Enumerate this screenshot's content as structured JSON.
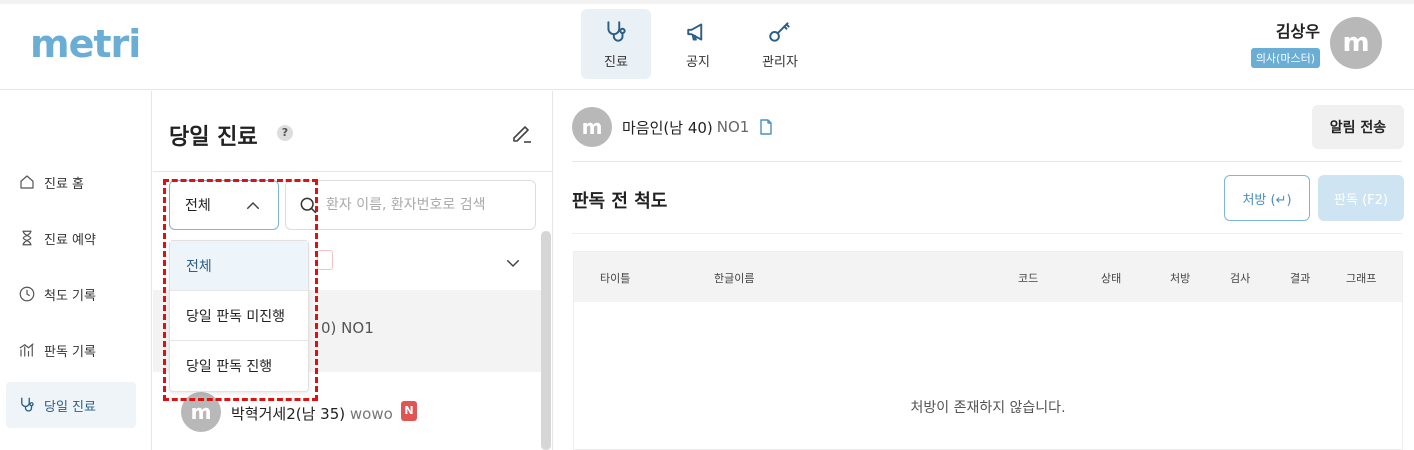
{
  "header": {
    "logo": "metri",
    "nav": [
      {
        "label": "진료",
        "icon": "stethoscope-icon",
        "active": true
      },
      {
        "label": "공지",
        "icon": "megaphone-icon",
        "active": false
      },
      {
        "label": "관리자",
        "icon": "key-icon",
        "active": false
      }
    ],
    "user": {
      "name": "김상우",
      "role": "의사(마스터)",
      "avatar_letter": "m"
    }
  },
  "sidebar": {
    "items": [
      {
        "label": "진료 홈",
        "icon": "home-icon"
      },
      {
        "label": "진료 예약",
        "icon": "hourglass-icon"
      },
      {
        "label": "척도 기록",
        "icon": "clock-icon"
      },
      {
        "label": "판독 기록",
        "icon": "bar-chart-icon"
      },
      {
        "label": "당일 진료",
        "icon": "stethoscope-icon",
        "active": true
      }
    ]
  },
  "mid": {
    "title": "당일 진료",
    "help": "?",
    "filter": {
      "selected": "전체",
      "options": [
        "전체",
        "당일 판독 미진행",
        "당일 판독 진행"
      ]
    },
    "search_placeholder": "환자 이름, 환자번호로 검색",
    "row1_partial": "0) NO1",
    "row2": {
      "avatar_letter": "m",
      "name": "박혁거세2(남 35)",
      "code": "wowo",
      "badge": "N"
    }
  },
  "right": {
    "patient": {
      "avatar_letter": "m",
      "name": "마음인(남 40)",
      "code": "NO1"
    },
    "notify_button": "알림 전송",
    "section_title": "판독 전 척도",
    "btn_prescribe": "처방 (↵)",
    "btn_judge": "판독 (F2)",
    "table": {
      "headers": [
        "타이틀",
        "한글이름",
        "코드",
        "상태",
        "처방",
        "검사",
        "결과",
        "그래프"
      ],
      "empty_message": "처방이 존재하지 않습니다."
    }
  },
  "colors": {
    "accent": "#6aaed6",
    "highlight": "#dd1111",
    "badge": "#e05454"
  }
}
